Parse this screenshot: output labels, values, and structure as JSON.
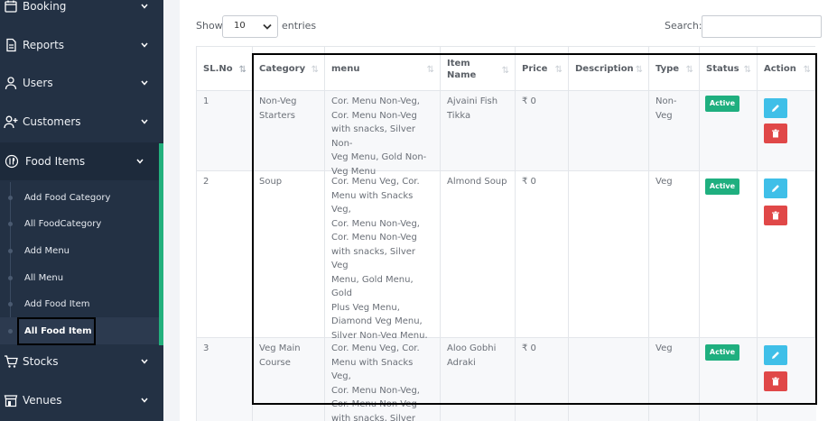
{
  "sidebar": {
    "items": [
      {
        "label": "Booking",
        "icon": "calendar-icon"
      },
      {
        "label": "Reports",
        "icon": "document-icon"
      },
      {
        "label": "Users",
        "icon": "user-icon"
      },
      {
        "label": "Customers",
        "icon": "add-user-icon"
      },
      {
        "label": "Food Items",
        "icon": "restaurant-icon"
      },
      {
        "label": "Stocks",
        "icon": "cart-icon"
      },
      {
        "label": "Venues",
        "icon": "store-icon"
      }
    ],
    "food_items_sub": [
      {
        "label": "Add Food Category"
      },
      {
        "label": "All FoodCategory"
      },
      {
        "label": "Add Menu"
      },
      {
        "label": "All Menu"
      },
      {
        "label": "Add Food Item"
      },
      {
        "label": "All Food Item"
      }
    ]
  },
  "controls": {
    "show_label": "Show",
    "show_value": "10",
    "entries_label": "entries",
    "search_label": "Search:"
  },
  "table": {
    "headers": [
      "SL.No",
      "Category",
      "menu",
      "Item\nName",
      "Price",
      "Description",
      "Type",
      "Status",
      "Action"
    ],
    "rows": [
      {
        "sl": "1",
        "category": "Non-Veg\nStarters",
        "menu": "Cor. Menu Non-Veg,\nCor. Menu Non-Veg\nwith snacks, Silver Non-\nVeg Menu, Gold Non-\nVeg Menu",
        "item": "Ajvaini Fish\nTikka",
        "price": "₹ 0",
        "description": "",
        "type": "Non-Veg",
        "status": "Active"
      },
      {
        "sl": "2",
        "category": "Soup",
        "menu": "Cor. Menu Veg, Cor.\nMenu with Snacks Veg,\nCor. Menu Non-Veg,\nCor. Menu Non-Veg\nwith snacks, Silver Veg\nMenu, Gold Menu, Gold\nPlus Veg Menu,\nDiamond Veg Menu,\nSilver Non-Veg Menu,\nGold Non-Veg Menu,\nSpecial Menu",
        "item": "Almond Soup",
        "price": "₹ 0",
        "description": "",
        "type": "Veg",
        "status": "Active"
      },
      {
        "sl": "3",
        "category": "Veg Main\nCourse",
        "menu": "Cor. Menu Veg, Cor.\nMenu with Snacks Veg,\nCor. Menu Non-Veg,\nCor. Menu Non-Veg\nwith snacks, Silver Veg\nMenu, Gold Menu, Gold",
        "item": "Aloo Gobhi\nAdraki",
        "price": "₹ 0",
        "description": "",
        "type": "Veg",
        "status": "Active"
      }
    ]
  },
  "colors": {
    "sidebar_bg": "#233144",
    "accent": "#23b07d",
    "badge_active": "#1faf7f",
    "edit_button": "#3fbfe8",
    "delete_button": "#e04848"
  }
}
